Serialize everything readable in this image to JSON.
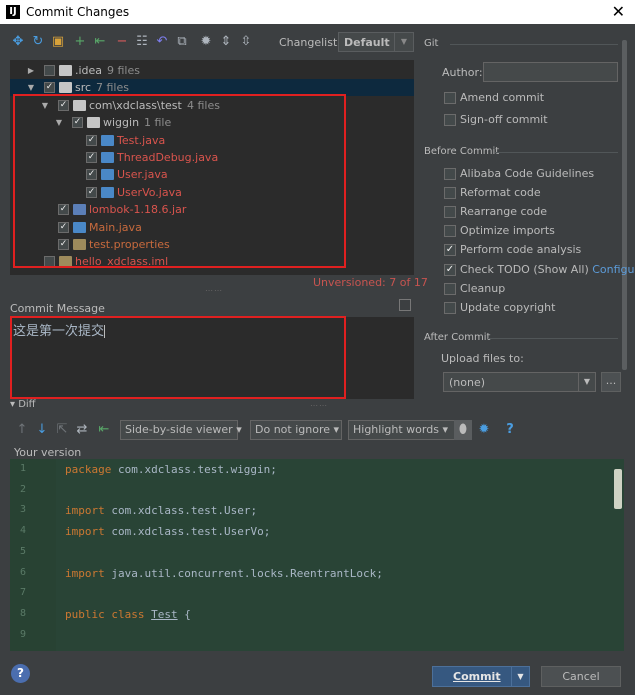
{
  "window": {
    "title": "Commit Changes",
    "app_icon": "IJ",
    "close": "✕"
  },
  "toolbar": {
    "changelist_label": "Changelist:",
    "changelist_value": "Default",
    "icons": [
      {
        "name": "diff-arrows-icon",
        "glyph": "✥",
        "color": "#4a9de0"
      },
      {
        "name": "refresh-icon",
        "glyph": "↻",
        "color": "#4a9de0"
      },
      {
        "name": "shelve-icon",
        "glyph": "▣",
        "color": "#d8a23a"
      },
      {
        "name": "add-icon",
        "glyph": "+",
        "color": "#59a869"
      },
      {
        "name": "revert-icon",
        "glyph": "⇤",
        "color": "#59a869"
      },
      {
        "name": "remove-icon",
        "glyph": "−",
        "color": "#db5c5c"
      },
      {
        "name": "group-icon",
        "glyph": "☷",
        "color": "#aeb5bd"
      },
      {
        "name": "undo-icon",
        "glyph": "↶",
        "color": "#7f7ff0"
      },
      {
        "name": "move-icon",
        "glyph": "⧉",
        "color": "#aeb5bd"
      },
      {
        "name": "settings-icon",
        "glyph": "✹",
        "color": "#aeb5bd"
      },
      {
        "name": "expand-all-icon",
        "glyph": "⇕",
        "color": "#aeb5bd"
      },
      {
        "name": "collapse-all-icon",
        "glyph": "⇳",
        "color": "#aeb5bd"
      }
    ]
  },
  "tree": {
    "rows": [
      {
        "name": "idea-folder",
        "toggle": "▶",
        "checked": false,
        "icon": "folder",
        "label": ".idea",
        "count": "9 files",
        "cls": ""
      },
      {
        "name": "src-folder",
        "toggle": "▼",
        "checked": true,
        "icon": "folder",
        "label": "src",
        "count": "7 files",
        "cls": ""
      },
      {
        "name": "package-folder",
        "toggle": "▼",
        "checked": true,
        "icon": "folder",
        "label": "com\\xdclass\\test",
        "count": "4 files",
        "cls": ""
      },
      {
        "name": "wiggin-folder",
        "toggle": "▼",
        "checked": true,
        "icon": "folder",
        "label": "wiggin",
        "count": "1 file",
        "cls": ""
      },
      {
        "name": "test-java-file",
        "toggle": "",
        "checked": true,
        "icon": "java",
        "label": "Test.java",
        "count": "",
        "cls": "red-txt"
      },
      {
        "name": "threaddebug-java-file",
        "toggle": "",
        "checked": true,
        "icon": "java",
        "label": "ThreadDebug.java",
        "count": "",
        "cls": "red-txt"
      },
      {
        "name": "user-java-file",
        "toggle": "",
        "checked": true,
        "icon": "java",
        "label": "User.java",
        "count": "",
        "cls": "red-txt"
      },
      {
        "name": "uservo-java-file",
        "toggle": "",
        "checked": true,
        "icon": "java",
        "label": "UserVo.java",
        "count": "",
        "cls": "red-txt"
      },
      {
        "name": "lombok-jar-file",
        "toggle": "",
        "checked": true,
        "icon": "jar",
        "label": "lombok-1.18.6.jar",
        "count": "",
        "cls": "red-txt"
      },
      {
        "name": "main-java-file",
        "toggle": "",
        "checked": true,
        "icon": "java",
        "label": "Main.java",
        "count": "",
        "cls": "orange-txt"
      },
      {
        "name": "test-properties-file",
        "toggle": "",
        "checked": true,
        "icon": "prop",
        "label": "test.properties",
        "count": "",
        "cls": "orange-txt"
      },
      {
        "name": "hello-iml-file",
        "toggle": "",
        "checked": false,
        "icon": "prop",
        "label": "hello_xdclass.iml",
        "count": "",
        "cls": "red-txt"
      }
    ],
    "unversioned": "Unversioned: 7 of 17"
  },
  "commit_message": {
    "label": "Commit Message",
    "value": "这是第一次提交"
  },
  "git": {
    "section": "Git",
    "author_label": "Author:",
    "author_value": "",
    "options": [
      {
        "name": "amend-commit-checkbox",
        "label": "Amend commit",
        "checked": false
      },
      {
        "name": "sign-off-commit-checkbox",
        "label": "Sign-off commit",
        "checked": false
      }
    ]
  },
  "before_commit": {
    "section": "Before Commit",
    "options": [
      {
        "name": "alibaba-guidelines-checkbox",
        "label": "Alibaba Code Guidelines",
        "checked": false
      },
      {
        "name": "reformat-code-checkbox",
        "label": "Reformat code",
        "checked": false
      },
      {
        "name": "rearrange-code-checkbox",
        "label": "Rearrange code",
        "checked": false
      },
      {
        "name": "optimize-imports-checkbox",
        "label": "Optimize imports",
        "checked": false
      },
      {
        "name": "perform-analysis-checkbox",
        "label": "Perform code analysis",
        "checked": true
      },
      {
        "name": "check-todo-checkbox",
        "label": "Check TODO (Show All)",
        "checked": true,
        "link": "Configure"
      },
      {
        "name": "cleanup-checkbox",
        "label": "Cleanup",
        "checked": false
      },
      {
        "name": "update-copyright-checkbox",
        "label": "Update copyright",
        "checked": false
      }
    ]
  },
  "after_commit": {
    "section": "After Commit",
    "upload_label": "Upload files to:",
    "upload_value": "(none)",
    "upload_button": "..."
  },
  "diff": {
    "header": "▾ Diff",
    "viewer": "Side-by-side viewer",
    "whitespace": "Do not ignore",
    "highlight": "Highlight words",
    "your_version": "Your version",
    "lines": [
      {
        "n": "1",
        "kw": "package",
        "rest": " com.xdclass.test.wiggin;",
        "ul": ""
      },
      {
        "n": "2",
        "kw": "",
        "rest": "",
        "ul": ""
      },
      {
        "n": "3",
        "kw": "import",
        "rest": " com.xdclass.test.User;",
        "ul": ""
      },
      {
        "n": "4",
        "kw": "import",
        "rest": " com.xdclass.test.UserVo;",
        "ul": ""
      },
      {
        "n": "5",
        "kw": "",
        "rest": "",
        "ul": ""
      },
      {
        "n": "6",
        "kw": "import",
        "rest": " java.util.concurrent.locks.ReentrantLock;",
        "ul": ""
      },
      {
        "n": "7",
        "kw": "",
        "rest": "",
        "ul": ""
      },
      {
        "n": "8",
        "kw": "public class",
        "rest": " {",
        "ul": "Test"
      },
      {
        "n": "9",
        "kw": "",
        "rest": "",
        "ul": ""
      }
    ]
  },
  "footer": {
    "help": "?",
    "commit": "Commit",
    "cancel": "Cancel"
  }
}
